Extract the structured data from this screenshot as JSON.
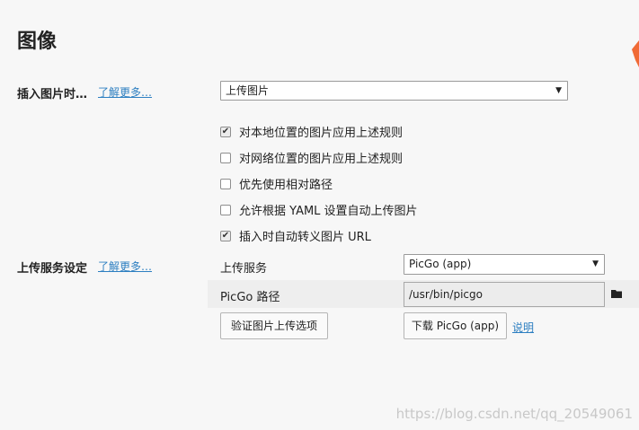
{
  "page": {
    "title": "图像"
  },
  "insert_section": {
    "label": "插入图片时…",
    "learn_more": "了解更多…",
    "dropdown_value": "上传图片",
    "options": [
      {
        "label": "对本地位置的图片应用上述规则",
        "checked": true
      },
      {
        "label": "对网络位置的图片应用上述规则",
        "checked": false
      },
      {
        "label": "优先使用相对路径",
        "checked": false
      },
      {
        "label": "允许根据 YAML 设置自动上传图片",
        "checked": false
      },
      {
        "label": "插入时自动转义图片 URL",
        "checked": true
      }
    ]
  },
  "upload_section": {
    "label": "上传服务设定",
    "learn_more": "了解更多…",
    "service_label": "上传服务",
    "service_value": "PicGo (app)",
    "path_label": "PicGo 路径",
    "path_value": "/usr/bin/picgo",
    "verify_button": "验证图片上传选项",
    "download_button": "下载 PicGo (app)",
    "help_link": "说明"
  },
  "watermark": "https://blog.csdn.net/qq_20549061",
  "icons": {
    "dropdown": "triangle-down-icon",
    "folder": "folder-icon",
    "check": "checkmark-icon"
  }
}
